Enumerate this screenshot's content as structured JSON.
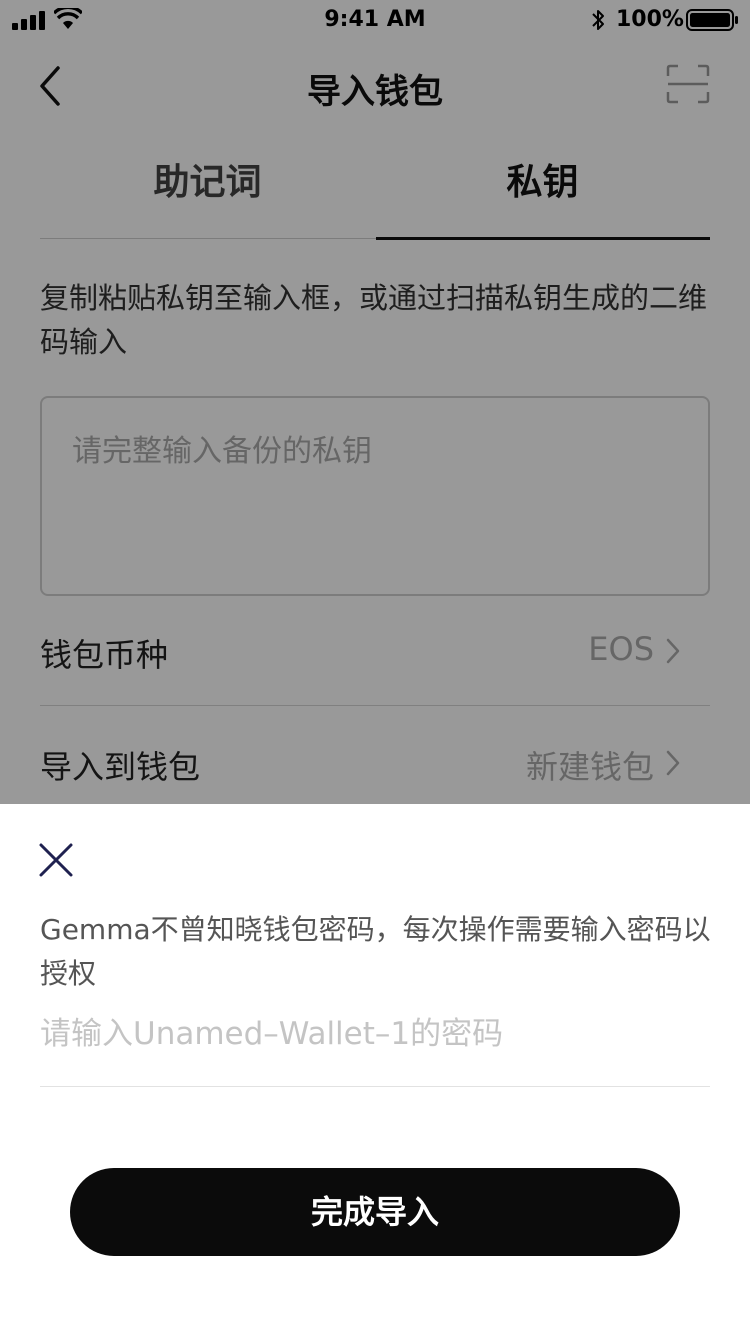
{
  "status_bar": {
    "time": "9:41 AM",
    "battery": "100%"
  },
  "nav": {
    "title": "导入钱包",
    "back_icon": "chevron-left-icon",
    "scan_icon": "scan-icon"
  },
  "tabs": [
    {
      "label": "助记词",
      "active": false
    },
    {
      "label": "私钥",
      "active": true
    }
  ],
  "instruction": "复制粘贴私钥至输入框，或通过扫描私钥生成的二维码输入",
  "private_key_input": {
    "placeholder": "请完整输入备份的私钥",
    "value": ""
  },
  "rows": {
    "coin": {
      "label": "钱包币种",
      "value": "EOS"
    },
    "wallet": {
      "label": "导入到钱包",
      "value": "新建钱包"
    }
  },
  "sheet": {
    "close_icon": "close-icon",
    "description": "Gemma不曾知晓钱包密码，每次操作需要输入密码以授权",
    "password_placeholder": "请输入Unamed–Wallet–1的密码",
    "password_value": "",
    "submit_label": "完成导入"
  },
  "colors": {
    "overlay": "#000000",
    "button": "#0b0b0b",
    "close_icon": "#1f2150"
  }
}
